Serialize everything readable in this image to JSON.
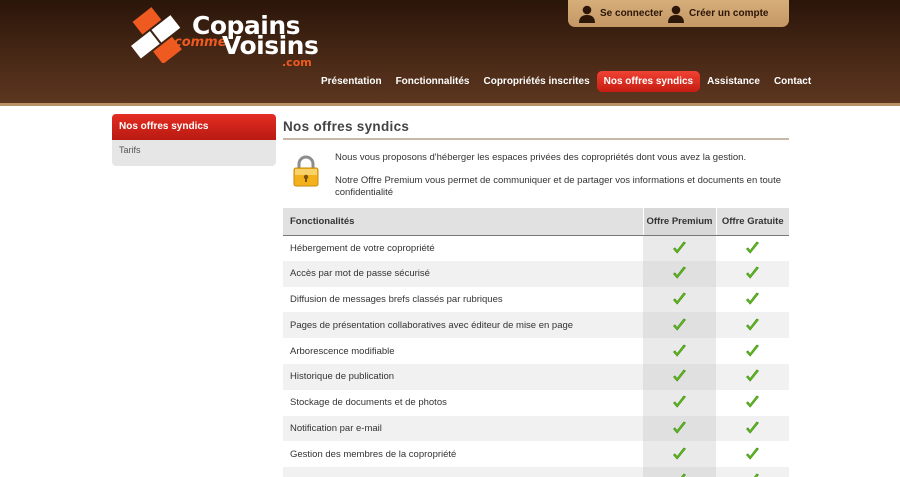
{
  "logo": {
    "line1": "Copains",
    "comme": "comme",
    "line2": "Voisins",
    "domain": ".com"
  },
  "account": {
    "login_label": "Se connecter",
    "signup_label": "Créer un compte"
  },
  "nav": {
    "items": [
      {
        "label": "Présentation"
      },
      {
        "label": "Fonctionnalités"
      },
      {
        "label": "Copropriétés inscrites"
      },
      {
        "label": "Nos offres syndics"
      },
      {
        "label": "Assistance"
      },
      {
        "label": "Contact"
      }
    ],
    "active_index": 3
  },
  "sidebar": {
    "title": "Nos offres syndics",
    "items": [
      {
        "label": "Tarifs"
      }
    ]
  },
  "main": {
    "title": "Nos offres syndics",
    "intro_1": "Nous vous proposons d'héberger les espaces privées des copropriétés dont vous avez la gestion.",
    "intro_2": "Notre Offre Premium vous permet de communiquer et de partager vos informations et documents en toute confidentialité"
  },
  "table": {
    "headers": [
      "Fonctionalités",
      "Offre Premium",
      "Offre Gratuite"
    ],
    "rows": [
      {
        "feature": "Hébergement de votre copropriété",
        "premium": true,
        "free": true
      },
      {
        "feature": "Accès par mot de passe sécurisé",
        "premium": true,
        "free": true
      },
      {
        "feature": "Diffusion de messages brefs classés par rubriques",
        "premium": true,
        "free": true
      },
      {
        "feature": "Pages de présentation collaboratives avec éditeur de mise en page",
        "premium": true,
        "free": true
      },
      {
        "feature": "Arborescence modifiable",
        "premium": true,
        "free": true
      },
      {
        "feature": "Historique de publication",
        "premium": true,
        "free": true
      },
      {
        "feature": "Stockage de documents et de photos",
        "premium": true,
        "free": true
      },
      {
        "feature": "Notification par e-mail",
        "premium": true,
        "free": true
      },
      {
        "feature": "Gestion des membres de la copropriété",
        "premium": true,
        "free": true
      },
      {
        "feature": "",
        "premium": true,
        "free": true
      }
    ]
  },
  "colors": {
    "header_brown": "#4a2a17",
    "accent_red": "#d42a1e",
    "logo_orange": "#ef5a20",
    "check_green": "#5fb81f"
  },
  "icons": {
    "login": "user-icon",
    "signup": "user-icon",
    "intro": "padlock-icon",
    "check": "check-icon"
  }
}
